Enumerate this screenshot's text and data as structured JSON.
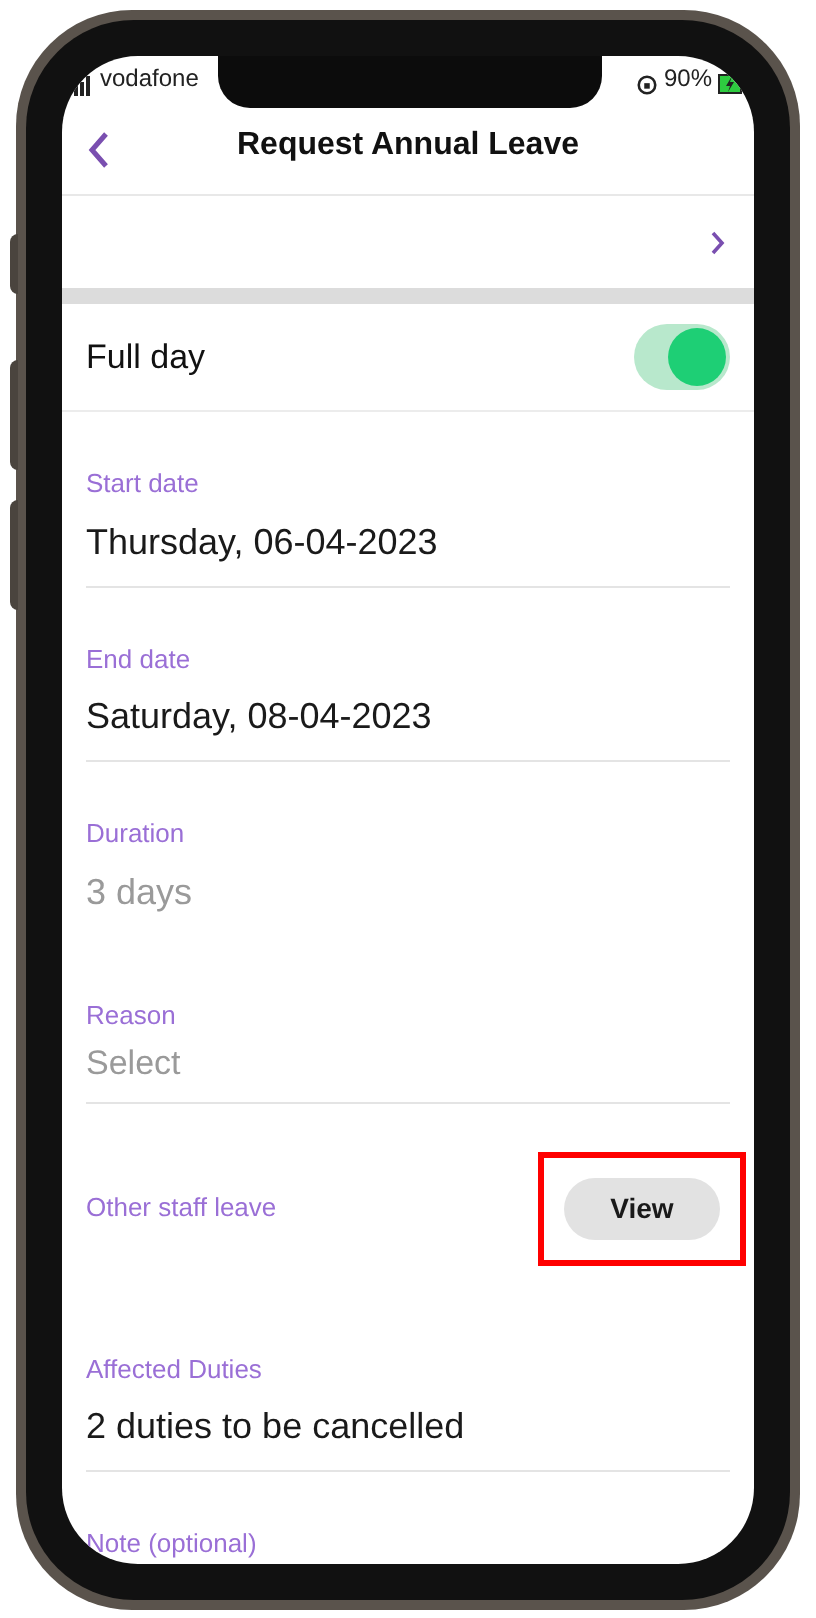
{
  "status_bar": {
    "carrier": "vodafone",
    "battery": "90%"
  },
  "header": {
    "title": "Request Annual Leave"
  },
  "full_day": {
    "label": "Full day",
    "on": true
  },
  "fields": [
    {
      "kind": "value",
      "label": "Start date",
      "value": "Thursday, 06-04-2023"
    },
    {
      "kind": "value",
      "label": "End date",
      "value": "Saturday, 08-04-2023"
    },
    {
      "kind": "muted",
      "label": "Duration",
      "value": "3 days"
    },
    {
      "kind": "select",
      "label": "Reason",
      "placeholder": "Select"
    },
    {
      "kind": "button",
      "label": "Other staff leave",
      "button": "View",
      "highlighted": true
    },
    {
      "kind": "value",
      "label": "Affected Duties",
      "value": "2 duties to be cancelled"
    },
    {
      "kind": "label",
      "label": "Note (optional)"
    }
  ]
}
